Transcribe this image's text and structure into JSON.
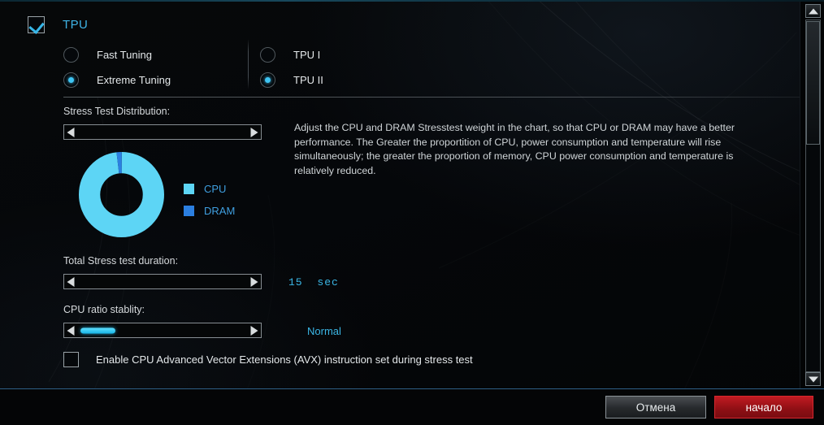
{
  "header": {
    "checkbox_checked": true,
    "title": "TPU"
  },
  "tuning_modes": {
    "left": [
      {
        "label": "Fast Tuning",
        "selected": false
      },
      {
        "label": "Extreme Tuning",
        "selected": true
      }
    ],
    "right": [
      {
        "label": "TPU I",
        "selected": false
      },
      {
        "label": "TPU II",
        "selected": true
      }
    ]
  },
  "stress_distribution": {
    "label": "Stress Test Distribution:",
    "slider": {
      "left_arrow": "left-arrow",
      "right_arrow": "right-arrow",
      "handle_visible": false
    },
    "legend": [
      {
        "label": "CPU",
        "color": "#5DD5F5"
      },
      {
        "label": "DRAM",
        "color": "#2B7FE0"
      }
    ],
    "description": "Adjust the CPU and DRAM Stresstest weight in the chart, so that CPU or DRAM may have a better performance. The Greater the proportition of CPU, power consumption and temperature will rise simultaneously; the greater the proportion of memory, CPU power consumption and temperature is relatively reduced."
  },
  "chart_data": {
    "type": "pie",
    "title": "Stress Test Distribution",
    "labels": [
      "CPU",
      "DRAM"
    ],
    "values": [
      98,
      2
    ],
    "colors": [
      "#5DD5F5",
      "#2B7FE0"
    ],
    "donut": true,
    "inner_radius_ratio": 0.5,
    "legend_position": "right",
    "units": "%"
  },
  "duration": {
    "label": "Total Stress test duration:",
    "value": "15",
    "unit": "sec"
  },
  "stability": {
    "label": "CPU ratio stablity:",
    "value": "Normal",
    "handle_position_pct": 4
  },
  "avx": {
    "checked": false,
    "label": "Enable CPU Advanced Vector Extensions (AVX) instruction set during stress test"
  },
  "scrollbar": {
    "up_arrow": "scroll-up-arrow",
    "down_arrow": "scroll-down-arrow"
  },
  "footer": {
    "cancel_label": "Отмена",
    "start_label": "начало"
  },
  "colors": {
    "accent_cyan": "#3FB4E6",
    "cpu": "#5DD5F5",
    "dram": "#2B7FE0",
    "start_red": "#C11B22"
  }
}
